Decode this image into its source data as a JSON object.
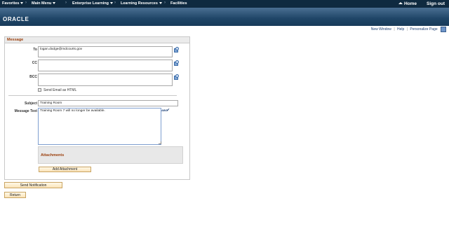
{
  "nav": {
    "items": [
      "Favorites",
      "Main Menu",
      "Enterprise Learning",
      "Learning Resources",
      "Facilities"
    ],
    "home": "Home",
    "signout": "Sign out"
  },
  "brand": {
    "logo": "ORACLE"
  },
  "page_links": {
    "new_window": "New Window",
    "help": "Help",
    "personalize": "Personalize Page",
    "separator": "|"
  },
  "section": {
    "title": "Message"
  },
  "form": {
    "to_label": "To",
    "to_value": "logan.dodge@mdcourts.gov",
    "cc_label": "CC",
    "cc_value": "",
    "bcc_label": "BCC",
    "bcc_value": "",
    "html_checkbox_label": "Send Email as HTML",
    "html_checked": false,
    "subject_label": "Subject",
    "subject_value": "Training Room",
    "message_label": "Message Text",
    "message_value": "Training Room 7 will no longer be available."
  },
  "attachments": {
    "title": "Attachments",
    "add_button": "Add Attachment"
  },
  "actions": {
    "send": "Send Notification",
    "return": "Return"
  },
  "colors": {
    "nav_bg": "#0f2a40",
    "section_title": "#9b3f0c",
    "link": "#1a3d73"
  }
}
